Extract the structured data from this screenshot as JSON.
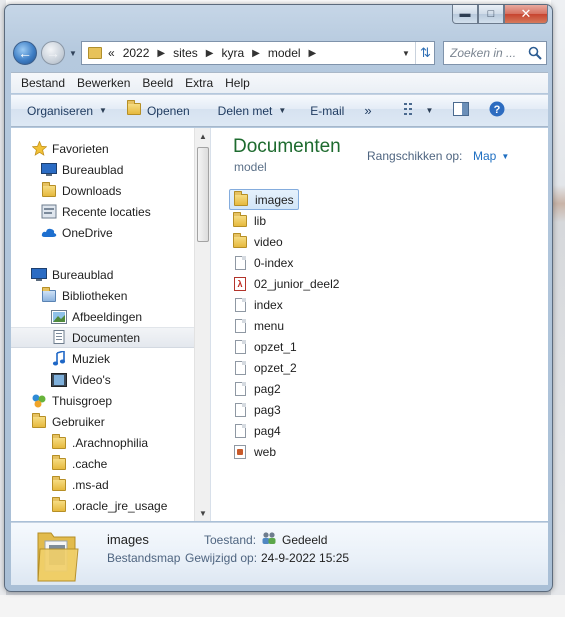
{
  "address": {
    "overflow": "«",
    "crumbs": [
      "2022",
      "sites",
      "kyra",
      "model"
    ]
  },
  "search": {
    "placeholder": "Zoeken in ..."
  },
  "menubar": [
    "Bestand",
    "Bewerken",
    "Beeld",
    "Extra",
    "Help"
  ],
  "toolbar": {
    "organize": "Organiseren",
    "open": "Openen",
    "share": "Delen met",
    "email": "E-mail",
    "more": "»"
  },
  "nav_tree": [
    {
      "label": "Favorieten",
      "icon": "star-icon"
    },
    {
      "label": "Bureaublad",
      "icon": "desktop-icon"
    },
    {
      "label": "Downloads",
      "icon": "downloads-icon"
    },
    {
      "label": "Recente locaties",
      "icon": "recent-places-icon"
    },
    {
      "label": "OneDrive",
      "icon": "onedrive-icon"
    },
    {
      "label": "Bureaublad",
      "icon": "desktop-icon"
    },
    {
      "label": "Bibliotheken",
      "icon": "libraries-icon"
    },
    {
      "label": "Afbeeldingen",
      "icon": "pictures-icon"
    },
    {
      "label": "Documenten",
      "icon": "documents-icon",
      "selected": true
    },
    {
      "label": "Muziek",
      "icon": "music-icon"
    },
    {
      "label": "Video's",
      "icon": "videos-icon"
    },
    {
      "label": "Thuisgroep",
      "icon": "homegroup-icon"
    },
    {
      "label": "Gebruiker",
      "icon": "user-folder-icon"
    },
    {
      "label": ".Arachnophilia",
      "icon": "folder-icon"
    },
    {
      "label": ".cache",
      "icon": "folder-icon"
    },
    {
      "label": ".ms-ad",
      "icon": "folder-icon"
    },
    {
      "label": ".oracle_jre_usage",
      "icon": "folder-icon"
    }
  ],
  "library": {
    "title": "Documenten",
    "subtitle": "model",
    "arrange_label": "Rangschikken op:",
    "arrange_value": "Map"
  },
  "files": [
    {
      "name": "images",
      "icon": "folder-icon",
      "selected": true
    },
    {
      "name": "lib",
      "icon": "folder-icon"
    },
    {
      "name": "video",
      "icon": "folder-icon"
    },
    {
      "name": "0-index",
      "icon": "document-icon"
    },
    {
      "name": "02_junior_deel2",
      "icon": "pdf-icon"
    },
    {
      "name": "index",
      "icon": "document-icon"
    },
    {
      "name": "menu",
      "icon": "document-icon"
    },
    {
      "name": "opzet_1",
      "icon": "document-icon"
    },
    {
      "name": "opzet_2",
      "icon": "document-icon"
    },
    {
      "name": "pag2",
      "icon": "document-icon"
    },
    {
      "name": "pag3",
      "icon": "document-icon"
    },
    {
      "name": "pag4",
      "icon": "document-icon"
    },
    {
      "name": "web",
      "icon": "web-document-icon"
    }
  ],
  "details": {
    "name": "images",
    "type": "Bestandsmap",
    "state_label": "Toestand:",
    "state_value": "Gedeeld",
    "modified_label": "Gewijzigd op:",
    "modified_value": "24-9-2022 15:25"
  },
  "colors": {
    "library_title": "#1e6b2f",
    "link": "#1f6fc2",
    "selection_border": "#84acdd"
  }
}
